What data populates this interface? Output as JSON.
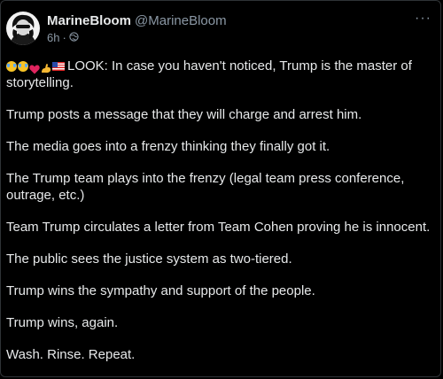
{
  "post": {
    "author": {
      "display_name": "MarineBloom",
      "handle": "@MarineBloom"
    },
    "timestamp": "6h",
    "separator": "·",
    "more_label": "···",
    "emojis": [
      "joy",
      "joy",
      "heart",
      "flexed-biceps",
      "us-flag"
    ],
    "paragraphs": [
      "LOOK: In case you haven't noticed, Trump is the master of storytelling.",
      "Trump posts a message that they will charge and arrest him.",
      "The media goes into a frenzy thinking they finally got it.",
      "The Trump team plays into the frenzy (legal team press conference, outrage, etc.)",
      "Team Trump circulates a letter from Team Cohen proving he is innocent.",
      "The public sees the justice system as two-tiered.",
      "Trump wins the sympathy and support of the people.",
      "Trump wins, again.",
      "Wash. Rinse. Repeat."
    ]
  },
  "colors": {
    "background": "#000000",
    "text": "#e7e9ea",
    "secondary_text": "#8b98a5",
    "border": "#2f3336"
  }
}
